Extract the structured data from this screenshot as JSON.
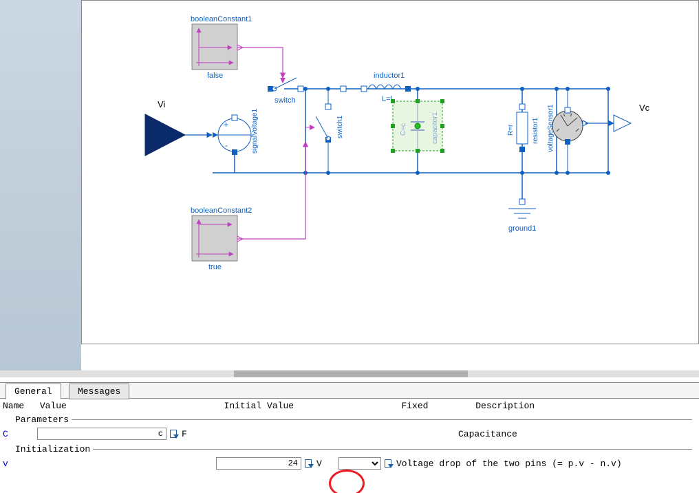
{
  "canvas": {
    "input_label": "Vi",
    "output_label": "Vc",
    "components": {
      "booleanConstant1": {
        "name": "booleanConstant1",
        "value": "false"
      },
      "booleanConstant2": {
        "name": "booleanConstant2",
        "value": "true"
      },
      "signalVoltage1": {
        "name": "signalVoltage1",
        "plus": "+",
        "minus": "-"
      },
      "switch": {
        "name": "switch"
      },
      "switch1": {
        "name": "switch1"
      },
      "inductor1": {
        "name": "inductor1",
        "param": "L=l"
      },
      "capacitor1": {
        "name": "capacitor1",
        "param": "C=c"
      },
      "resistor1": {
        "name": "resistor1",
        "param": "R=r"
      },
      "voltageSensor1": {
        "name": "voltageSensor1"
      },
      "ground1": {
        "name": "ground1"
      }
    }
  },
  "panel": {
    "tabs": {
      "general": "General",
      "messages": "Messages"
    },
    "headers": {
      "name": "Name",
      "value": "Value",
      "initial": "Initial Value",
      "fixed": "Fixed",
      "desc": "Description"
    },
    "groups": {
      "parameters": "Parameters",
      "initialization": "Initialization"
    },
    "rows": {
      "C": {
        "name": "C",
        "value": "c",
        "unit": "F",
        "desc": "Capacitance"
      },
      "v": {
        "name": "v",
        "initial": "24",
        "unit": "V",
        "desc": "Voltage drop of the two pins (= p.v - n.v)"
      }
    }
  }
}
